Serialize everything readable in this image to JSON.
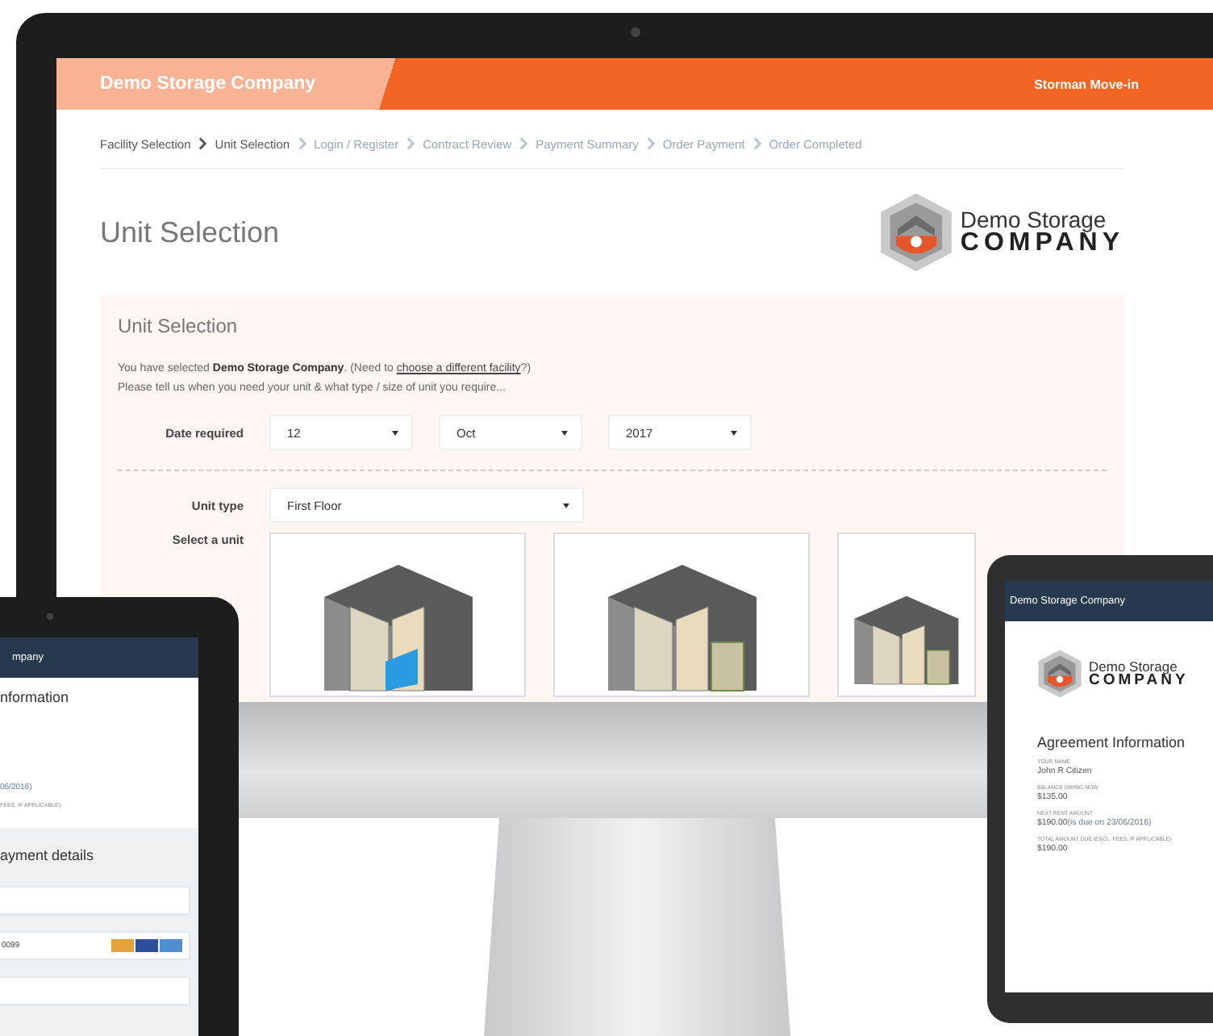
{
  "desktop": {
    "header": {
      "brand": "Demo Storage Company",
      "app": "Storman Move-in"
    },
    "steps": [
      {
        "label": "Facility Selection",
        "disabled": false
      },
      {
        "label": "Unit Selection",
        "disabled": false
      },
      {
        "label": "Login / Register",
        "disabled": true
      },
      {
        "label": "Contract Review",
        "disabled": true
      },
      {
        "label": "Payment Summary",
        "disabled": true
      },
      {
        "label": "Order Payment",
        "disabled": true
      },
      {
        "label": "Order Completed",
        "disabled": true
      }
    ],
    "page_title": "Unit Selection",
    "logo": {
      "line1": "Demo Storage",
      "line2": "COMPANY"
    },
    "panel": {
      "title": "Unit Selection",
      "intro_before": "You have selected **Demo Storage Company**. (Need to ",
      "intro_link": "choose a different facility",
      "intro_after": "?)",
      "intro_line2": "Please tell us when you need your unit & what type / size of unit you require...",
      "date_label": "Date required",
      "date_fields": [
        {
          "value": "12"
        },
        {
          "value": "Oct"
        },
        {
          "value": "2017"
        }
      ],
      "unit_type_label": "Unit type",
      "unit_type": "First Floor",
      "select_label": "Select a unit"
    }
  },
  "tablet_left": {
    "header": "mpany",
    "title": "nformation",
    "due": "06/2016)",
    "total_label": "FEES, IF APPLICABLE)",
    "payment_title": "ayment details",
    "card_number": "0099"
  },
  "tablet_right": {
    "header": "Demo Storage Company",
    "logo": {
      "line1": "Demo Storage",
      "line2": "COMPANY"
    },
    "title": "Agreement Information",
    "fields": [
      {
        "label": "YOUR NAME",
        "value": "John R Citizen"
      },
      {
        "label": "BALANCE OWING NOW",
        "value": "$135.00"
      },
      {
        "label": "NEXT RENT AMOUNT",
        "value": "$190.00",
        "note": "(is due on 23/06/2016)"
      },
      {
        "label": "TOTAL AMOUNT DUE (EXCL. FEES, IF APPLICABLE)",
        "value": "$190.00"
      }
    ]
  }
}
